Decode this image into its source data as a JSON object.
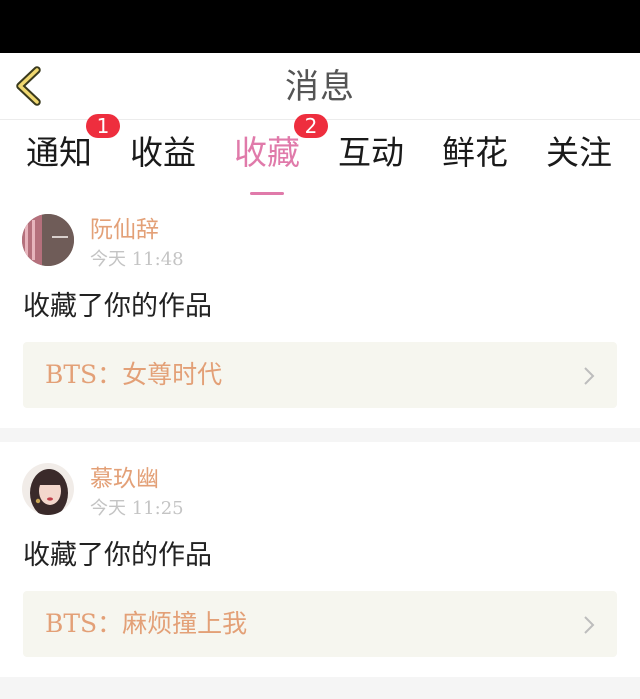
{
  "header": {
    "title": "消息"
  },
  "tabs": [
    {
      "label": "通知",
      "badge": "1",
      "active": false
    },
    {
      "label": "收益",
      "badge": "",
      "active": false
    },
    {
      "label": "收藏",
      "badge": "2",
      "active": true
    },
    {
      "label": "互动",
      "badge": "",
      "active": false
    },
    {
      "label": "鲜花",
      "badge": "",
      "active": false
    },
    {
      "label": "关注",
      "badge": "",
      "active": false
    }
  ],
  "messages": [
    {
      "username": "阮仙辞",
      "time": "今天 11:48",
      "action": "收藏了你的作品",
      "work_title": "BTS：女尊时代"
    },
    {
      "username": "慕玖幽",
      "time": "今天 11:25",
      "action": "收藏了你的作品",
      "work_title": "BTS：麻烦撞上我"
    }
  ],
  "colors": {
    "accent": "#e07aaa",
    "name": "#e3a077",
    "badge": "#ee2e3e",
    "work_bg": "#f6f6ef"
  }
}
